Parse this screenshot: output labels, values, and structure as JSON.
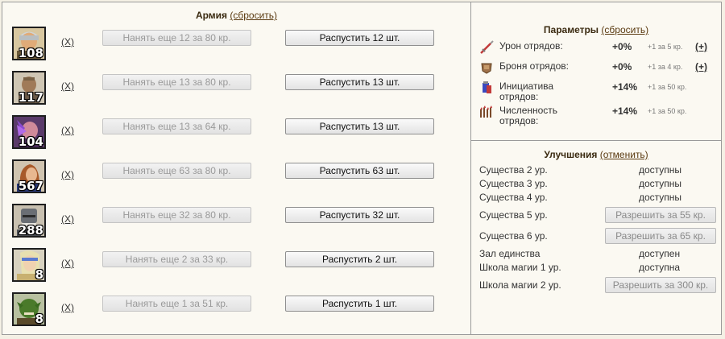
{
  "army": {
    "title": "Армия",
    "reset_link": "(сбросить)",
    "remove_label": "(X)",
    "units": [
      {
        "count": "108",
        "hire_label": "Нанять еще 12 за 80 кр.",
        "dismiss_label": "Распустить 12 шт."
      },
      {
        "count": "117",
        "hire_label": "Нанять еще 13 за 80 кр.",
        "dismiss_label": "Распустить 13 шт."
      },
      {
        "count": "104",
        "hire_label": "Нанять еще 13 за 64 кр.",
        "dismiss_label": "Распустить 13 шт."
      },
      {
        "count": "567",
        "hire_label": "Нанять еще 63 за 80 кр.",
        "dismiss_label": "Распустить 63 шт."
      },
      {
        "count": "288",
        "hire_label": "Нанять еще 32 за 80 кр.",
        "dismiss_label": "Распустить 32 шт."
      },
      {
        "count": "8",
        "hire_label": "Нанять еще 2 за 33 кр.",
        "dismiss_label": "Распустить 2 шт."
      },
      {
        "count": "8",
        "hire_label": "Нанять еще 1 за 51 кр.",
        "dismiss_label": "Распустить 1 шт."
      }
    ]
  },
  "params": {
    "title": "Параметры",
    "reset_link": "(сбросить)",
    "items": [
      {
        "icon": "sword-icon",
        "label": "Урон отрядов:",
        "value": "+0%",
        "note": "+1 за 5 кр.",
        "plus": "(+)"
      },
      {
        "icon": "armor-icon",
        "label": "Броня отрядов:",
        "value": "+0%",
        "note": "+1 за 4 кр.",
        "plus": "(+)"
      },
      {
        "icon": "initiative-icon",
        "label": "Инициатива отрядов:",
        "value": "+14%",
        "note": "+1 за 50 кр."
      },
      {
        "icon": "troops-icon",
        "label": "Численность отрядов:",
        "value": "+14%",
        "note": "+1 за 50 кр."
      }
    ]
  },
  "upgrades": {
    "title": "Улучшения",
    "cancel_link": "(отменить)",
    "items": [
      {
        "name": "Существа 2 ур.",
        "status": "доступны"
      },
      {
        "name": "Существа 3 ур.",
        "status": "доступны"
      },
      {
        "name": "Существа 4 ур.",
        "status": "доступны"
      },
      {
        "name": "Существа 5 ур.",
        "button": "Разрешить за 55 кр."
      },
      {
        "name": "Существа 6 ур.",
        "button": "Разрешить за 65 кр."
      },
      {
        "name": "Зал единства",
        "status": "доступен"
      },
      {
        "name": "Школа магии 1 ур.",
        "status": "доступна"
      },
      {
        "name": "Школа магии 2 ур.",
        "button": "Разрешить за 300 кр."
      }
    ]
  }
}
